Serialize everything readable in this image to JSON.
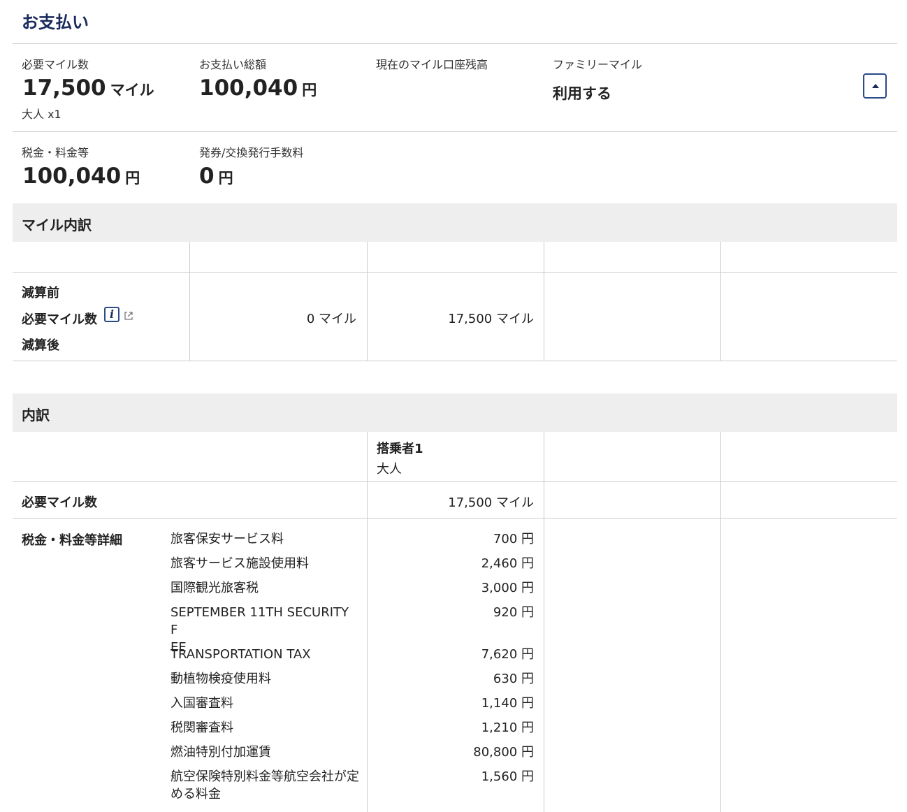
{
  "page_title": "お支払い",
  "summary": {
    "required_miles": {
      "label": "必要マイル数",
      "value": "17,500",
      "unit": "マイル",
      "sub": "大人 x1"
    },
    "total_payment": {
      "label": "お支払い総額",
      "value": "100,040",
      "unit": "円"
    },
    "mile_balance": {
      "label": "現在のマイル口座残高"
    },
    "family_mile": {
      "label": "ファミリーマイル",
      "value": "利用する"
    },
    "taxes": {
      "label": "税金・料金等",
      "value": "100,040",
      "unit": "円"
    },
    "issue_fee": {
      "label": "発券/交換発行手数料",
      "value": "0",
      "unit": "円"
    }
  },
  "mile_breakdown": {
    "title": "マイル内訳",
    "row_label_1": "減算前",
    "row_label_2": "必要マイル数",
    "row_label_3": "減算後",
    "col1_value": "0 マイル",
    "col2_value": "17,500 マイル"
  },
  "breakdown": {
    "title": "内訳",
    "passenger_header": "搭乗者1",
    "passenger_type": "大人",
    "required_miles_label": "必要マイル数",
    "required_miles_value": "17,500 マイル",
    "tax_detail_label": "税金・料金等詳細",
    "fees": [
      {
        "name": "旅客保安サービス料",
        "amount": "700 円"
      },
      {
        "name": "旅客サービス施設使用料",
        "amount": "2,460 円"
      },
      {
        "name": "国際観光旅客税",
        "amount": "3,000 円"
      },
      {
        "name": "SEPTEMBER 11TH SECURITY F\nEE",
        "amount": "920 円"
      },
      {
        "name": "TRANSPORTATION TAX",
        "amount": "7,620 円"
      },
      {
        "name": "動植物検疫使用料",
        "amount": "630 円"
      },
      {
        "name": "入国審査料",
        "amount": "1,140 円"
      },
      {
        "name": "税関審査料",
        "amount": "1,210 円"
      },
      {
        "name": "燃油特別付加運賃",
        "amount": "80,800 円"
      },
      {
        "name": "航空保険特別料金等航空会社が定める料金",
        "amount": "1,560 円"
      }
    ]
  },
  "colors": {
    "title": "#1a2b5c",
    "border": "#cccccc",
    "section_bg": "#eeeeee",
    "icon": "#2a4a8a"
  },
  "icons": {
    "collapse": "chevron-up-icon",
    "info": "info-icon",
    "external": "external-link-icon"
  }
}
